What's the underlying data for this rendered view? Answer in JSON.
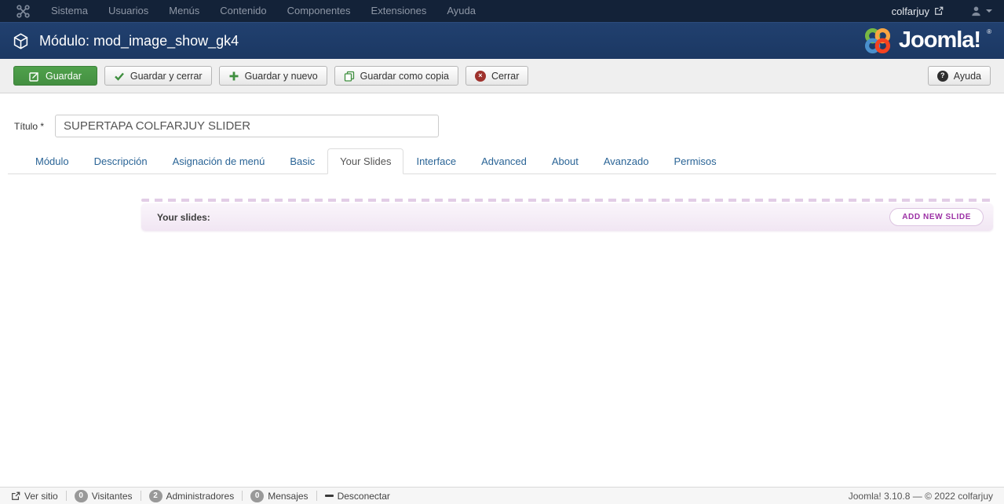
{
  "topbar": {
    "menu": [
      "Sistema",
      "Usuarios",
      "Menús",
      "Contenido",
      "Componentes",
      "Extensiones",
      "Ayuda"
    ],
    "site_name": "colfarjuy"
  },
  "header": {
    "title": "Módulo: mod_image_show_gk4",
    "logo_text": "Joomla!",
    "logo_reg": "®"
  },
  "toolbar": {
    "save": "Guardar",
    "save_close": "Guardar y cerrar",
    "save_new": "Guardar y nuevo",
    "save_copy": "Guardar como copia",
    "close": "Cerrar",
    "help": "Ayuda",
    "close_glyph": "×",
    "help_glyph": "?"
  },
  "form": {
    "title_label": "Título *",
    "title_value": "SUPERTAPA COLFARJUY SLIDER"
  },
  "tabs": {
    "items": [
      "Módulo",
      "Descripción",
      "Asignación de menú",
      "Basic",
      "Your Slides",
      "Interface",
      "Advanced",
      "About",
      "Avanzado",
      "Permisos"
    ],
    "active": "Your Slides"
  },
  "slides": {
    "header": "Your slides:",
    "add_button": "ADD NEW SLIDE"
  },
  "footer": {
    "view_site": "Ver sitio",
    "visitors_count": "0",
    "visitors_label": "Visitantes",
    "admins_count": "2",
    "admins_label": "Administradores",
    "messages_count": "0",
    "messages_label": "Mensajes",
    "logout": "Desconectar",
    "version_text": "Joomla! 3.10.8  —  © 2022 colfarjuy"
  },
  "colors": {
    "topbar_bg": "#132238",
    "header_bg": "#1e3c69",
    "accent_green": "#459345",
    "accent_purple": "#9c31a5",
    "link_blue": "#2a6496"
  }
}
